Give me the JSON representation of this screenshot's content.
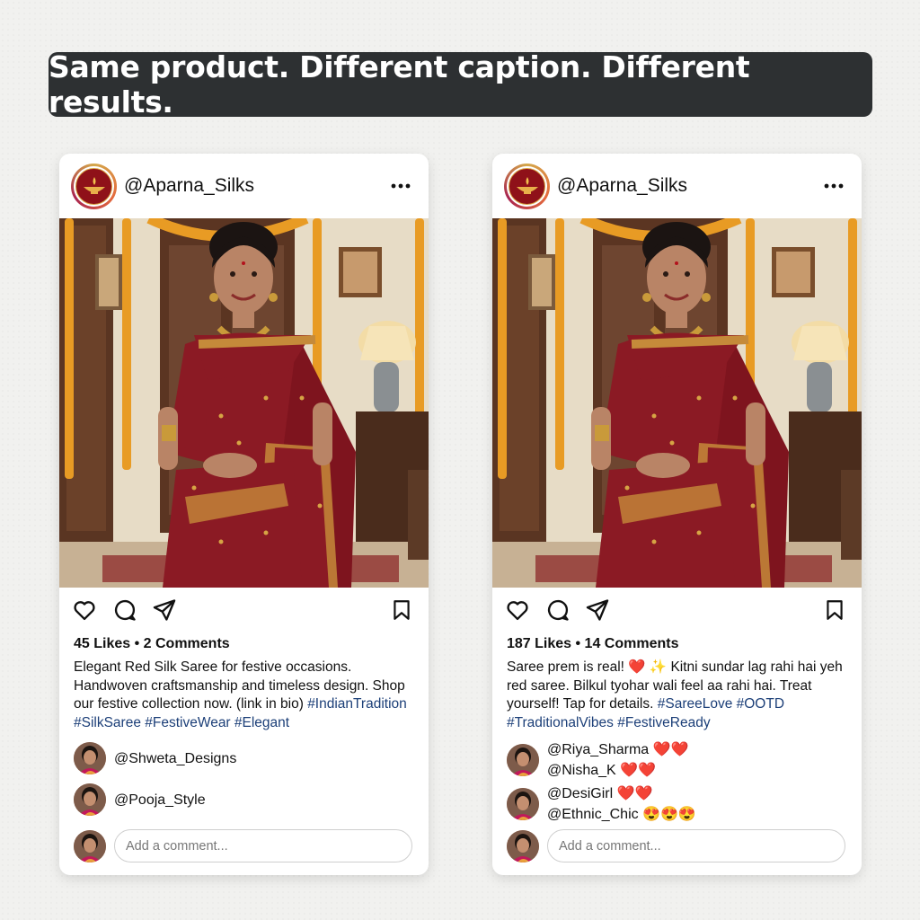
{
  "banner": {
    "text": "Same product. Different caption. Different results."
  },
  "posts": [
    {
      "username": "@Aparna_Silks",
      "stats": "45 Likes • 2 Comments",
      "caption": "Elegant Red Silk Saree for festive occasions. Handwoven craftsmanship and timeless design. Shop our festive collection now. (link in bio)",
      "hashtags": "#IndianTradition #SilkSaree #FestiveWear #Elegant",
      "comments": [
        {
          "text": "@Shweta_Designs"
        },
        {
          "text": "@Pooja_Style"
        }
      ],
      "add_comment_placeholder": "Add a comment..."
    },
    {
      "username": "@Aparna_Silks",
      "stats": "187 Likes • 14 Comments",
      "caption": "Saree prem is real! ❤️ ✨ Kitni sundar lag rahi hai yeh red saree. Bilkul tyohar wali feel aa rahi hai. Treat yourself! Tap for details.",
      "hashtags": "#SareeLove #OOTD #TraditionalVibes #FestiveReady",
      "comments": [
        {
          "line1": "@Riya_Sharma ❤️❤️",
          "line2": "@Nisha_K ❤️❤️"
        },
        {
          "line1": "@DesiGirl ❤️❤️",
          "line2": "@Ethnic_Chic 😍😍😍"
        }
      ],
      "add_comment_placeholder": "Add a comment..."
    }
  ],
  "icons": [
    "diya-logo-icon",
    "more-options-icon",
    "heart-icon",
    "comment-icon",
    "share-icon",
    "bookmark-icon"
  ],
  "colors": {
    "banner_bg": "#2d3032",
    "saree_red": "#8b1a24",
    "hashtag": "#1c3f78",
    "brand": "#8f1119"
  }
}
